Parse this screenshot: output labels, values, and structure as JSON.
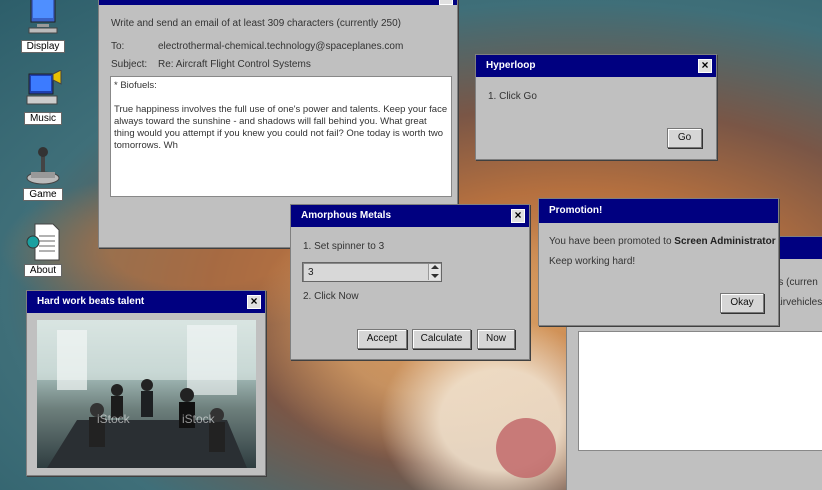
{
  "desktop_icons": [
    {
      "label": "Display",
      "icon": "display-monitor-icon"
    },
    {
      "label": "Music",
      "icon": "music-computer-icon"
    },
    {
      "label": "Game",
      "icon": "joystick-icon"
    },
    {
      "label": "About",
      "icon": "about-document-icon"
    }
  ],
  "email": {
    "instruction": "Write and send an email of at least 309 characters (currently 250)",
    "to_label": "To:",
    "to_value": "electrothermal-chemical.technology@spaceplanes.com",
    "subject_label": "Subject:",
    "subject_value": "Re: Aircraft Flight Control Systems",
    "body": "* Biofuels:\n\nTrue happiness involves the full use of one's power and talents. Keep your face always toward the sunshine - and shadows will fall behind you. What great thing would you attempt if you knew you could not fail? One today is worth two tomorrows. Wh"
  },
  "hyperloop": {
    "title": "Hyperloop",
    "step1": "1. Click Go",
    "go_label": "Go"
  },
  "amorphous": {
    "title": "Amorphous Metals",
    "step1": "1. Set spinner to 3",
    "spinner_value": "3",
    "step2": "2. Click Now",
    "accept_label": "Accept",
    "calculate_label": "Calculate",
    "now_label": "Now"
  },
  "promotion": {
    "title": "Promotion!",
    "message_prefix": "You have been promoted to ",
    "role": "Screen Administrator",
    "message2": "Keep working hard!",
    "okay_label": "Okay"
  },
  "hardwork": {
    "title": "Hard work beats talent",
    "watermark": "iStock"
  },
  "bg_window": {
    "text1": "rs (curren",
    "text2": "airvehicles"
  },
  "colors": {
    "titlebar": "#000080",
    "window": "#c0c0c0"
  }
}
